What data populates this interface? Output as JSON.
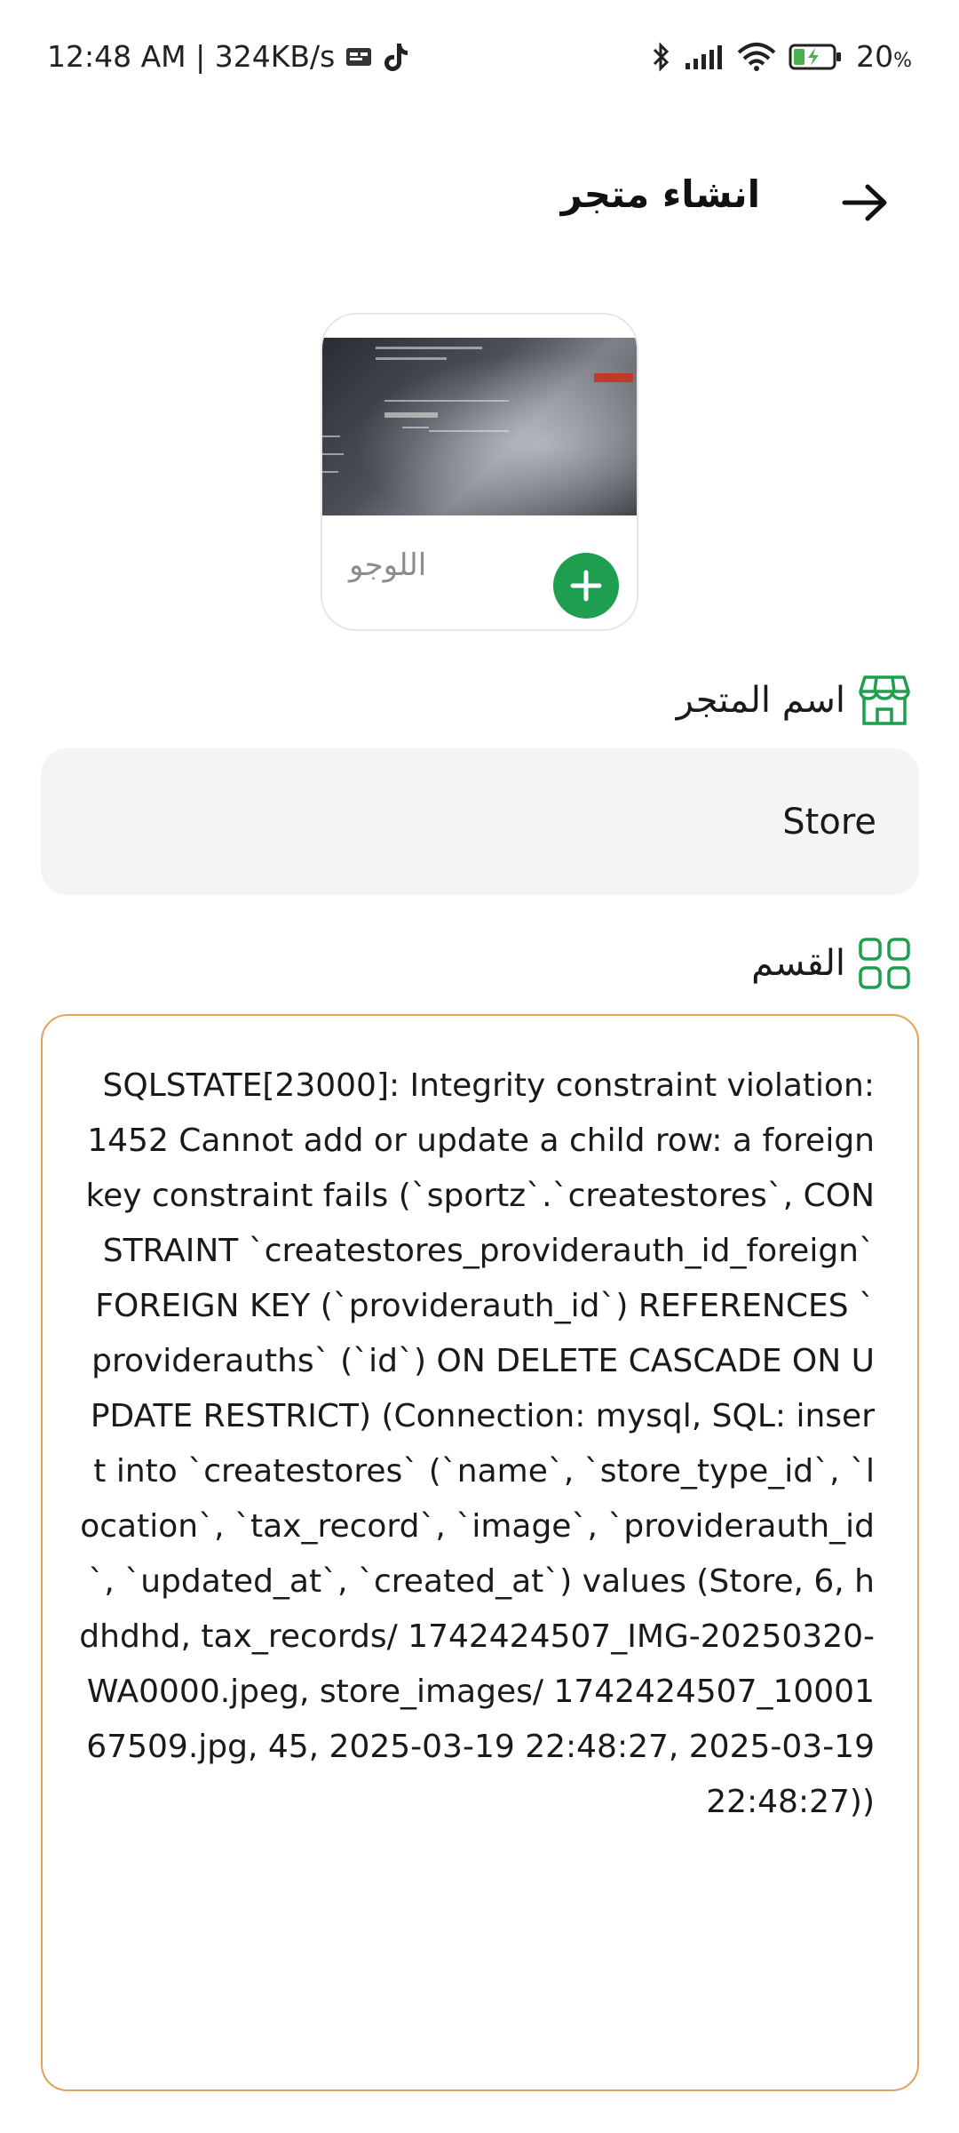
{
  "status_bar": {
    "left_text": "12:48 AM | 324KB/s",
    "battery": "20",
    "battery_unit": "%",
    "icons_left": [
      "sim-card-icon",
      "tiktok-icon"
    ],
    "icons_right": [
      "bluetooth-icon",
      "signal-icon",
      "wifi-icon",
      "battery-charging-icon"
    ]
  },
  "header": {
    "title": "انشاء متجر",
    "back_icon": "arrow-right-icon"
  },
  "logo": {
    "label": "اللوجو",
    "add_icon": "plus-icon",
    "accent": "#1e9e4f"
  },
  "store_name": {
    "label": "اسم المتجر",
    "icon": "store-icon",
    "value": "Store"
  },
  "category": {
    "label": "القسم",
    "icon": "grid-icon"
  },
  "error": {
    "border_color": "#e0a35a",
    "message": "SQLSTATE[23000]: Integrity constraint violation: 1452 Cannot add or update a child row: a foreign key constraint fails (`sportz`.`createstores`, CONSTRAINT `createstores_providerauth_id_foreign` FOREIGN KEY (`providerauth_id`) REFERENCES `providerauths` (`id`) ON DELETE CASCADE ON UPDATE RESTRICT) (Connection: mysql, SQL: insert into `createstores` (`name`, `store_type_id`, `location`, `tax_record`, `image`, `providerauth_id`, `updated_at`, `created_at`) values (Store, 6, hdhdhd, tax_records/ 1742424507_IMG-20250320-WA0000.jpeg, store_images/ 1742424507_1000167509.jpg, 45, 2025-03-19 22:48:27, 2025-03-19 22:48:27))"
  }
}
